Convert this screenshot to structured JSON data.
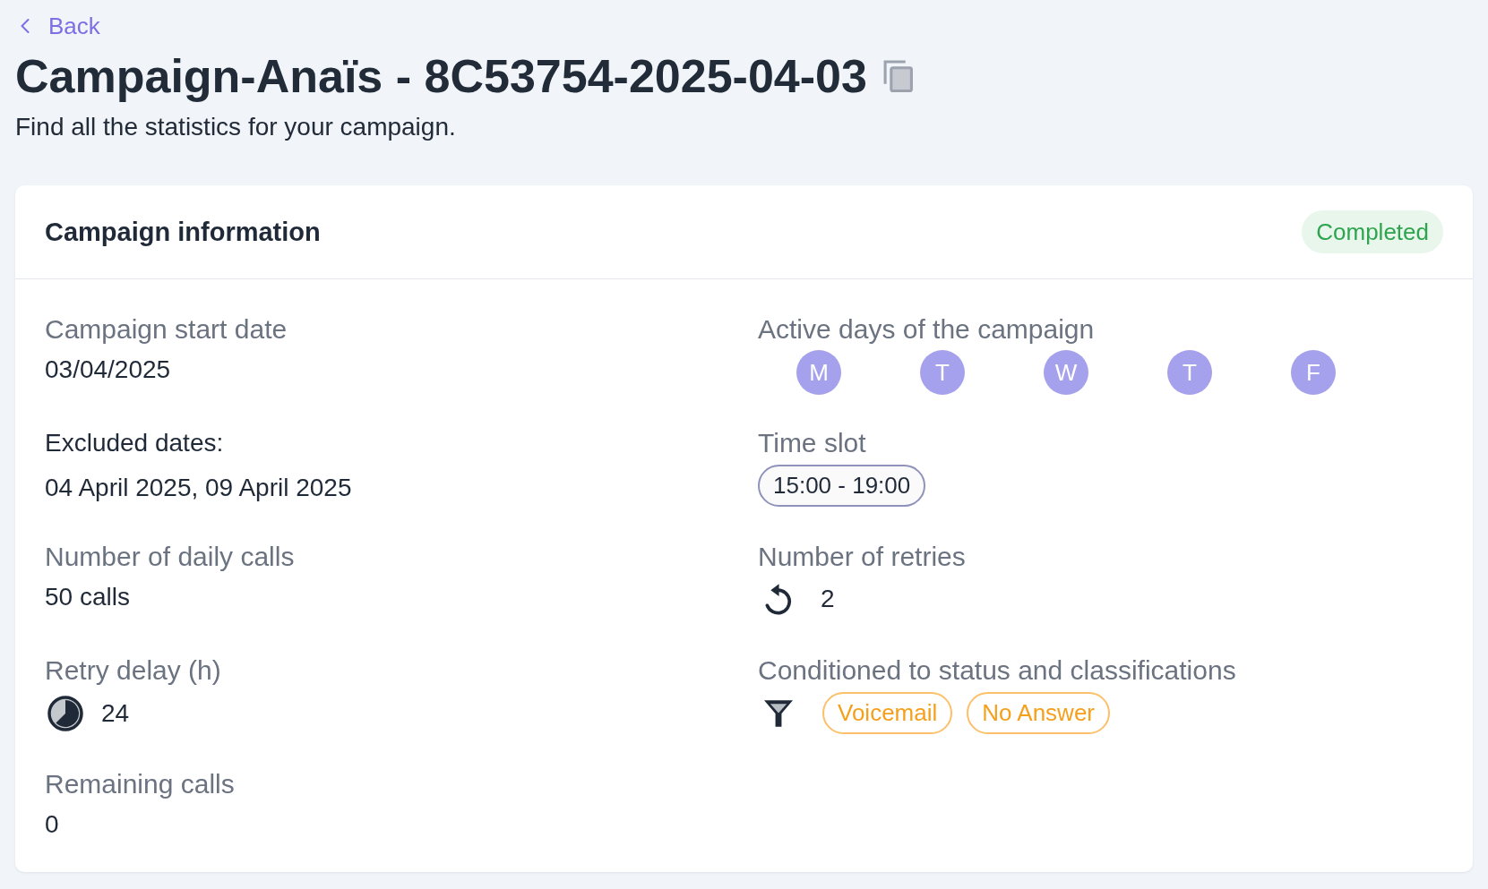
{
  "back_link": {
    "label": "Back"
  },
  "header": {
    "title": "Campaign-Anaïs - 8C53754-2025-04-03",
    "subtitle": "Find all the statistics for your campaign."
  },
  "card": {
    "title": "Campaign information",
    "status": {
      "label": "Completed",
      "kind": "completed"
    },
    "left_fields": [
      {
        "kind": "text",
        "label": "Campaign start date",
        "value": "03/04/2025"
      },
      {
        "kind": "dates",
        "label": "Excluded dates:",
        "value": "04 April 2025, 09 April 2025"
      },
      {
        "kind": "text",
        "label": "Number of daily calls",
        "value": "50 calls"
      },
      {
        "kind": "clock",
        "label": "Retry delay (h)",
        "value": "24"
      },
      {
        "kind": "text",
        "label": "Remaining calls",
        "value": "0"
      }
    ],
    "right_fields": [
      {
        "kind": "days",
        "label": "Active days of the campaign",
        "days": [
          "M",
          "T",
          "W",
          "T",
          "F"
        ]
      },
      {
        "kind": "time_slot",
        "label": "Time slot",
        "value": "15:00 - 19:00"
      },
      {
        "kind": "retries",
        "label": "Number of retries",
        "value": "2"
      },
      {
        "kind": "filter",
        "label": "Conditioned to status and classifications",
        "tags": [
          "Voicemail",
          "No Answer"
        ]
      }
    ]
  }
}
